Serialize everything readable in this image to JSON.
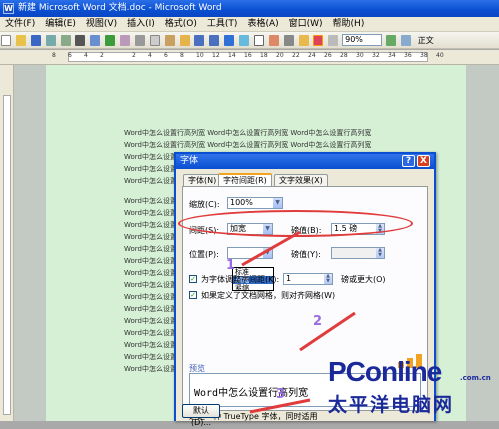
{
  "window": {
    "title": "新建 Microsoft Word 文档.doc - Microsoft Word",
    "icon": "W"
  },
  "menu": [
    "文件(F)",
    "编辑(E)",
    "视图(V)",
    "插入(I)",
    "格式(O)",
    "工具(T)",
    "表格(A)",
    "窗口(W)",
    "帮助(H)"
  ],
  "toolbar": {
    "zoom": "90%",
    "read_label": "正文"
  },
  "ruler": {
    "ticks": [
      "8",
      "6",
      "4",
      "2",
      "2",
      "4",
      "6",
      "8",
      "10",
      "12",
      "14",
      "16",
      "18",
      "20",
      "22",
      "24",
      "26",
      "28",
      "30",
      "32",
      "34",
      "36",
      "38",
      "40"
    ]
  },
  "document": {
    "lines": [
      "Word中怎么设置行高列宽 Word中怎么设置行高列宽 Word中怎么设置行高列宽",
      "Word中怎么设置行高列宽 Word中怎么设置行高列宽 Word中怎么设置行高列宽",
      "Word中怎么设置行高列宽",
      "Word中怎么设置行高列宽",
      "Word中怎么设置行高列宽",
      "Word中怎么设置行高列宽",
      "Word中怎么设置行高列宽",
      "Word中怎么设置行高列宽",
      "Word中怎么设置行高列宽",
      "Word中怎么设置行高列宽",
      "Word中怎么设置行高列宽",
      "Word中怎么设置行高列宽",
      "Word中怎么设置行高列宽",
      "Word中怎么设置行高列宽",
      "Word中怎么设置行高列宽",
      "Word中怎么设置行高列宽",
      "Word中怎么设置行高列宽",
      "Word中怎么设置行高列宽",
      "Word中怎么设置行高列宽",
      "Word中怎么设置行高列宽"
    ]
  },
  "dialog": {
    "title": "字体",
    "help": "?",
    "close": "X",
    "tabs": [
      "字体(N)",
      "字符间距(R)",
      "文字效果(X)"
    ],
    "scale_label": "缩放(C):",
    "scale_value": "100%",
    "spacing_label": "间距(S):",
    "spacing_value": "加宽",
    "spacing_by_label": "磅值(B):",
    "spacing_by_value": "1.5 磅",
    "spacing_options": [
      "标准",
      "加宽",
      "紧缩"
    ],
    "position_label": "位置(P):",
    "position_by_label": "磅值(Y):",
    "kerning_label": "为字体调整字间距(K):",
    "kerning_value": "1",
    "kerning_suffix": "磅或更大(O)",
    "grid_label": "如果定义了文档网格，则对齐网格(W)",
    "preview_label": "预览",
    "preview_text": "Word中怎么设置行高列宽",
    "footnote": "这是一种 TrueType 字体，同时适用",
    "default_button": "默认(D)..."
  },
  "annotations": [
    "1",
    "2",
    "3"
  ],
  "watermark": {
    "brand": "PConline",
    "domain": ".com.cn",
    "cname": "太平洋电脑网"
  }
}
